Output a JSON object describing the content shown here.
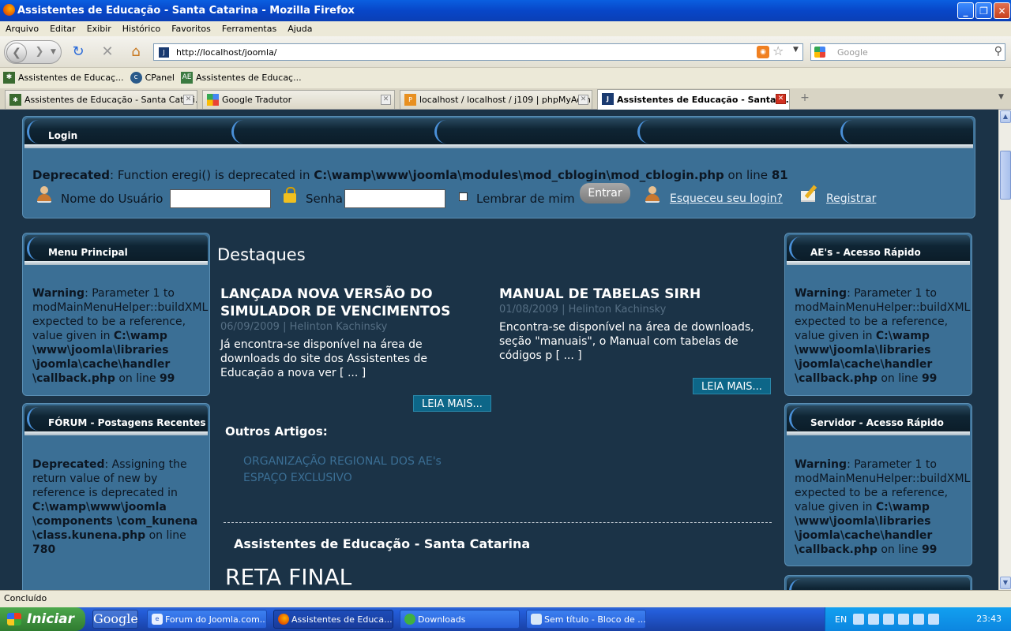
{
  "window": {
    "title": "Assistentes de Educação - Santa Catarina - Mozilla Firefox"
  },
  "menu": [
    "Arquivo",
    "Editar",
    "Exibir",
    "Histórico",
    "Favoritos",
    "Ferramentas",
    "Ajuda"
  ],
  "nav": {
    "url": "http://localhost/joomla/",
    "search_placeholder": "Google"
  },
  "bookmarks": [
    "Assistentes de Educaç...",
    "CPanel",
    "Assistentes de Educaç..."
  ],
  "tabs": [
    {
      "label": "Assistentes de Educação - Santa Catari..."
    },
    {
      "label": "Google Tradutor"
    },
    {
      "label": "localhost / localhost / j109 | phpMyAdm..."
    },
    {
      "label": "Assistentes de Educação - Santa ..."
    }
  ],
  "login": {
    "title": "Login",
    "deprecated_label": "Deprecated",
    "deprecated_msg": ": Function eregi() is deprecated in ",
    "deprecated_path": "C:\\wamp\\www\\joomla\\modules\\mod_cblogin\\mod_cblogin.php",
    "on_line": " on line ",
    "line_no": "81",
    "username_label": "Nome do Usuário",
    "password_label": "Senha",
    "remember_label": "Lembrar de mim",
    "submit_label": "Entrar",
    "forgot_label": "Esqueceu seu login?",
    "register_label": "Registrar"
  },
  "left_modules": [
    {
      "title": "Menu Principal",
      "type": "Warning",
      "msg": ": Parameter 1 to modMainMenuHelper::buildXML expected to be a reference, value given in ",
      "path": "C:\\wamp \\www\\joomla\\libraries \\joomla\\cache\\handler \\callback.php",
      "on_line": " on line ",
      "line_no": "99"
    },
    {
      "title": "FÓRUM - Postagens Recentes",
      "type": "Deprecated",
      "msg": ": Assigning the return value of new by reference is deprecated in ",
      "path": "C:\\wamp\\www\\joomla \\components \\com_kunena \\class.kunena.php",
      "on_line": " on line ",
      "line_no": "780"
    }
  ],
  "right_modules": [
    {
      "title": "AE's - Acesso Rápido",
      "type": "Warning",
      "msg": ": Parameter 1 to modMainMenuHelper::buildXML expected to be a reference, value given in ",
      "path": "C:\\wamp \\www\\joomla\\libraries \\joomla\\cache\\handler \\callback.php",
      "on_line": " on line ",
      "line_no": "99"
    },
    {
      "title": "Servidor - Acesso Rápido",
      "type": "Warning",
      "msg": ": Parameter 1 to modMainMenuHelper::buildXML expected to be a reference, value given in ",
      "path": "C:\\wamp \\www\\joomla\\libraries \\joomla\\cache\\handler \\callback.php",
      "on_line": " on line ",
      "line_no": "99"
    }
  ],
  "main": {
    "heading": "Destaques",
    "articles": [
      {
        "title": "LANÇADA NOVA VERSÃO DO SIMULADOR DE VENCIMENTOS",
        "date": "06/09/2009",
        "author": "Helinton Kachinsky",
        "body": "Já encontra-se disponível na área de downloads do site dos Assistentes de Educação a nova ver [ ... ]",
        "read_more": "LEIA MAIS..."
      },
      {
        "title": "MANUAL DE TABELAS SIRH",
        "date": "01/08/2009",
        "author": "Helinton Kachinsky",
        "body": "Encontra-se disponível na área de downloads, seção \"manuais\", o Manual com tabelas de códigos p [ ... ]",
        "read_more": "LEIA MAIS..."
      }
    ],
    "others_heading": "Outros Artigos:",
    "others": [
      "ORGANIZAÇÃO REGIONAL DOS AE's",
      "ESPAÇO EXCLUSIVO"
    ],
    "site_name": "Assistentes de Educação - Santa Catarina",
    "banner_heading": "RETA FINAL"
  },
  "status": "Concluído",
  "taskbar": {
    "start": "Iniciar",
    "google": "Google",
    "tasks": [
      "Forum do Joomla.com....",
      "Assistentes de Educa...",
      "Downloads",
      "Sem título - Bloco de ..."
    ],
    "lang": "EN",
    "time": "23:43"
  }
}
